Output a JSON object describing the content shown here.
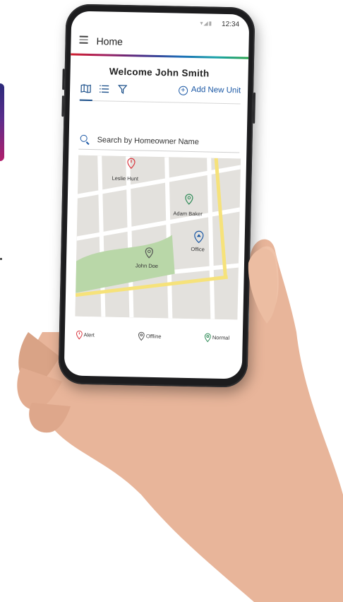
{
  "status_bar": {
    "time": "12:34"
  },
  "app_bar": {
    "title": "Home"
  },
  "welcome": {
    "text": "Welcome John Smith"
  },
  "toolbar": {
    "add_unit_label": "Add New Unit"
  },
  "search": {
    "placeholder": "Search by Homeowner Name"
  },
  "map": {
    "pins": [
      {
        "label": "Leslie Hunt",
        "status": "alert"
      },
      {
        "label": "Adam Baker",
        "status": "normal"
      },
      {
        "label": "John Doe",
        "status": "offline"
      },
      {
        "label": "Office",
        "status": "office"
      }
    ]
  },
  "legend": [
    {
      "label": "Alert",
      "color": "#d9363e"
    },
    {
      "label": "Offline",
      "color": "#555555"
    },
    {
      "label": "Normal",
      "color": "#2e8b57"
    }
  ],
  "colors": {
    "alert": "#d9363e",
    "normal": "#2e8b57",
    "offline": "#555555",
    "office": "#1b58a5",
    "accent": "#1b58a5",
    "park": "#b9d7a8",
    "road_highlight": "#f6e27a"
  }
}
